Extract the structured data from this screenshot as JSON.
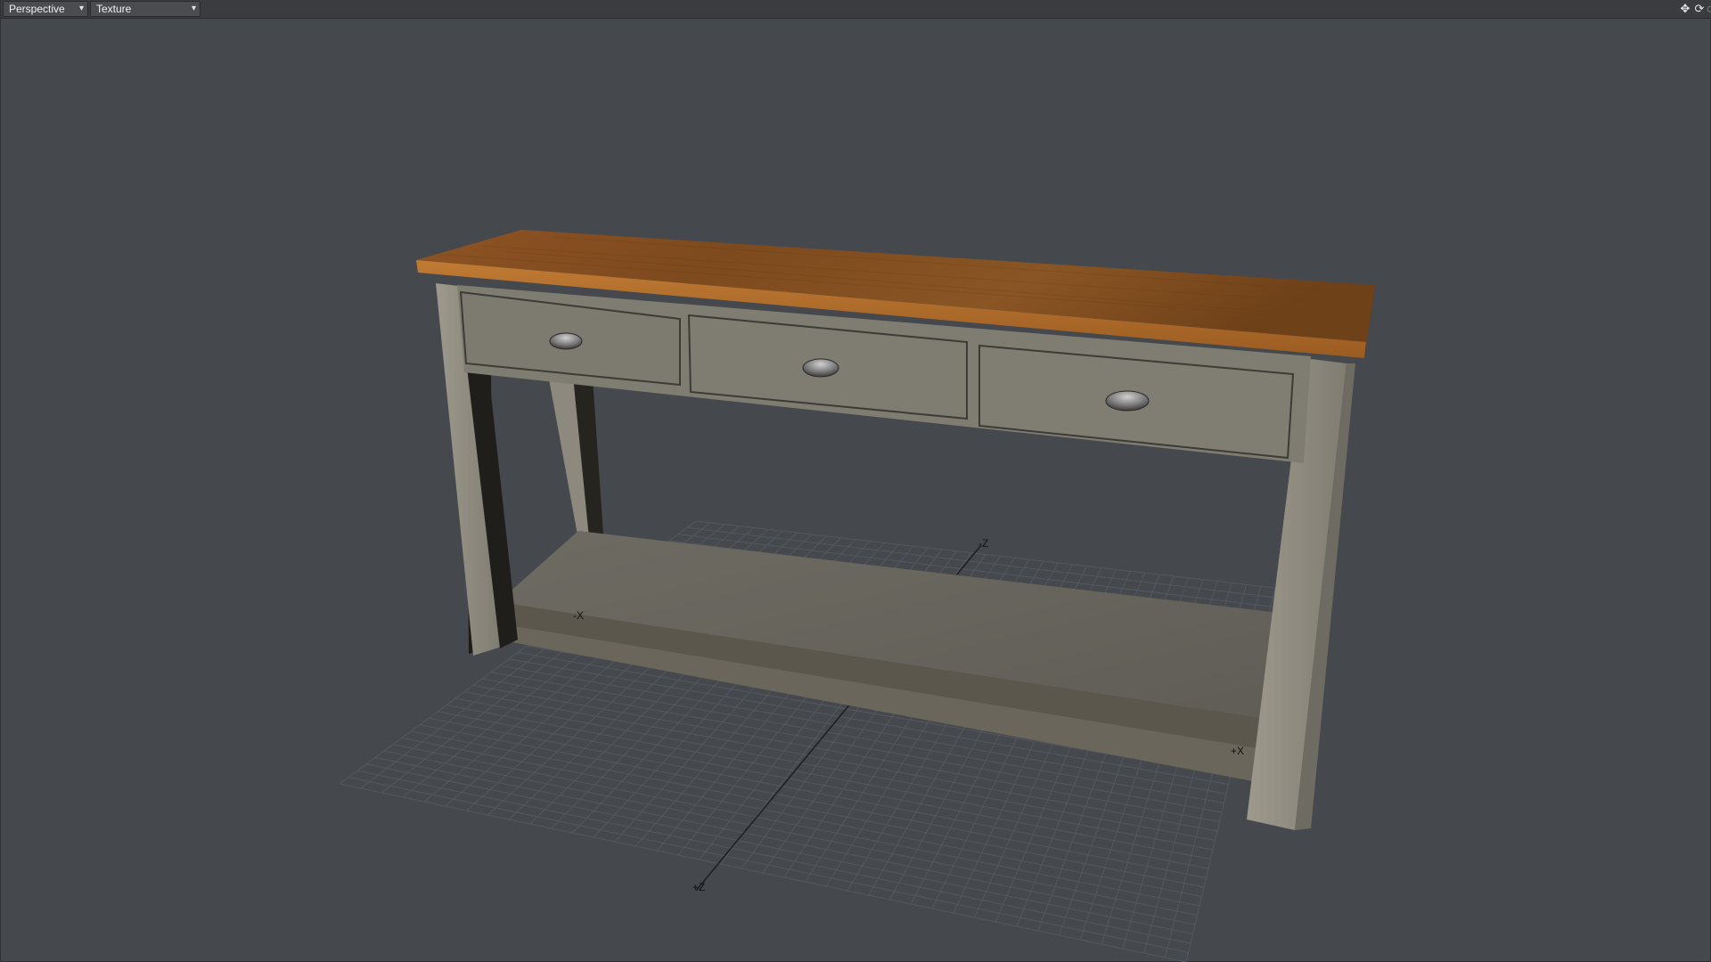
{
  "toolbar": {
    "view_mode": "Perspective",
    "shading_mode": "Texture"
  },
  "icons": {
    "move": "move-view-icon",
    "rotate": "rotate-view-icon",
    "zoom": "zoom-view-icon"
  },
  "axes": {
    "neg_z": "-Z",
    "neg_x": "-X",
    "pos_x": "+X",
    "pos_z": "+Z"
  },
  "colors": {
    "background": "#45484c",
    "grid": "#51555a",
    "wood": "#9a5a26",
    "paint": "#8a877c"
  }
}
